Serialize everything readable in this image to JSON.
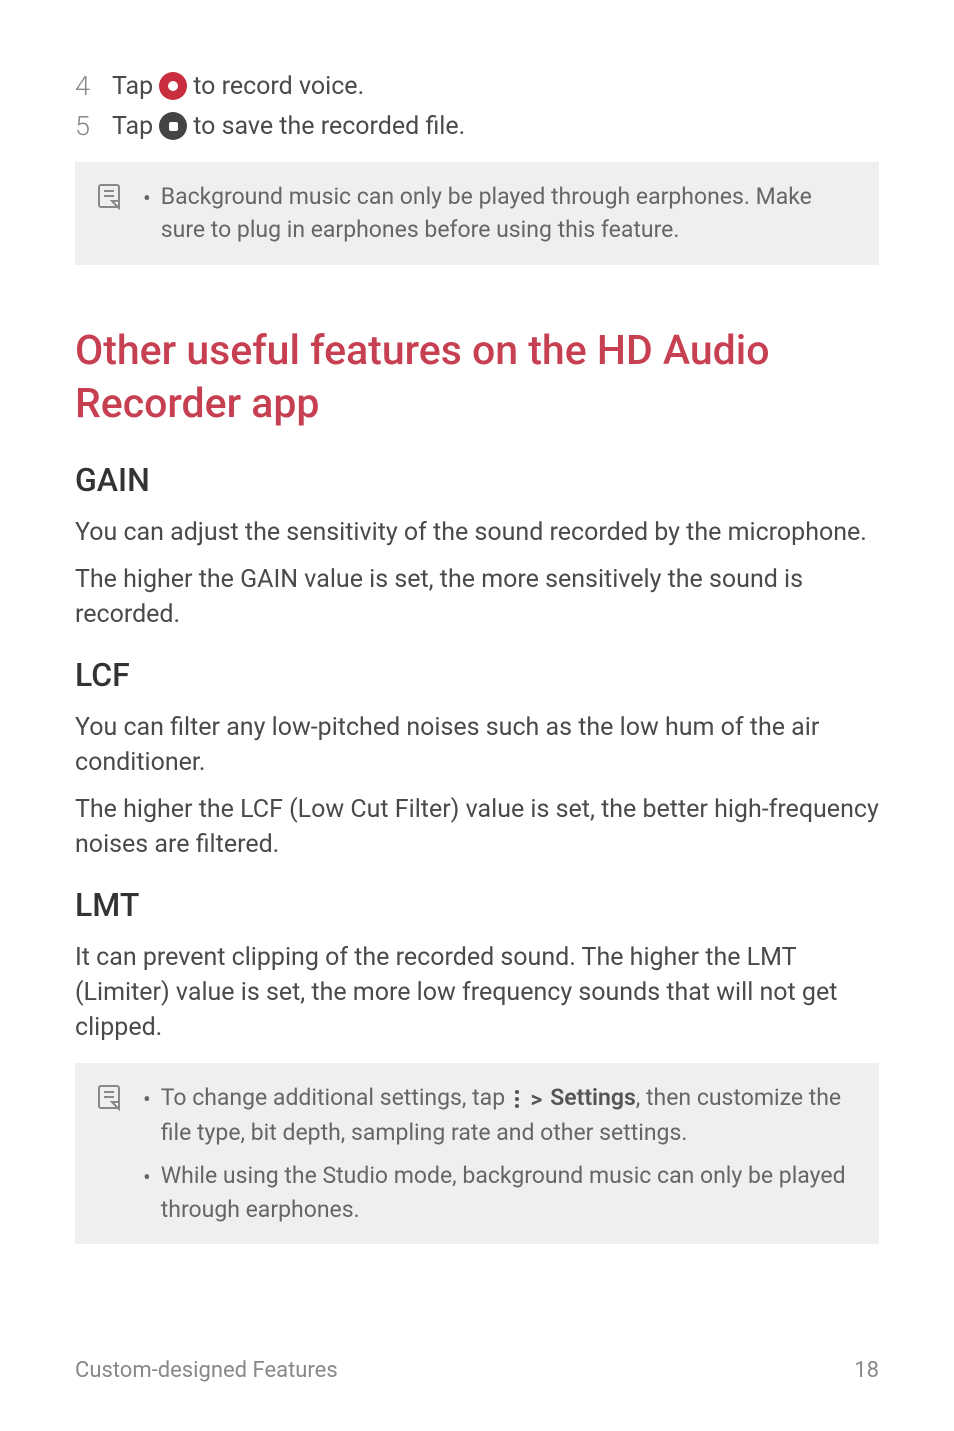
{
  "steps": {
    "s4": {
      "num": "4",
      "before": "Tap",
      "after": "to record voice."
    },
    "s5": {
      "num": "5",
      "before": "Tap",
      "after": "to save the recorded file."
    }
  },
  "note1": {
    "item1": "Background music can only be played through earphones. Make sure to plug in earphones before using this feature."
  },
  "main_heading": "Other useful features on the HD Audio Recorder app",
  "gain": {
    "heading": "GAIN",
    "p1": "You can adjust the sensitivity of the sound recorded by the microphone.",
    "p2": "The higher the GAIN value is set, the more sensitively the sound is recorded."
  },
  "lcf": {
    "heading": "LCF",
    "p1": "You can filter any low-pitched noises such as the low hum of the air conditioner.",
    "p2": "The higher the LCF (Low Cut Filter) value is set, the better high-frequency noises are filtered."
  },
  "lmt": {
    "heading": "LMT",
    "p1": "It can prevent clipping of the recorded sound. The higher the LMT (Limiter) value is set, the more low frequency sounds that will not get clipped."
  },
  "note2": {
    "item1_before": "To change additional settings, tap",
    "item1_settings": "Settings",
    "item1_after": ", then customize the file type, bit depth, sampling rate and other settings.",
    "item2": "While using the Studio mode, background music can only be played through earphones."
  },
  "footer": {
    "section": "Custom-designed Features",
    "page": "18"
  }
}
